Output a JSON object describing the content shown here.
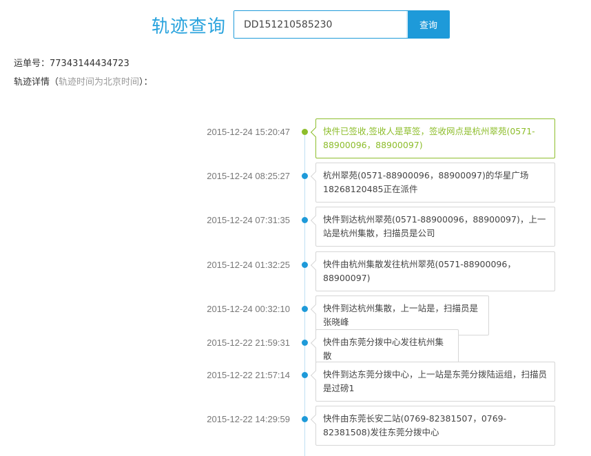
{
  "header": {
    "title": "轨迹查询",
    "search_value": "DD151210585230",
    "search_button": "查询"
  },
  "info": {
    "waybill_label": "运单号：",
    "waybill_number": "77343144434723",
    "detail_label": "轨迹详情（",
    "detail_note": "轨迹时间为北京时间",
    "detail_suffix": "）："
  },
  "events": [
    {
      "time": "2015-12-24 15:20:47",
      "text": "快件已签收,签收人是草签，签收网点是杭州翠苑(0571-88900096，88900097)",
      "current": true
    },
    {
      "time": "2015-12-24 08:25:27",
      "text": "杭州翠苑(0571-88900096，88900097)的华星广场18268120485正在派件",
      "current": false
    },
    {
      "time": "2015-12-24 07:31:35",
      "text": "快件到达杭州翠苑(0571-88900096，88900097)，上一站是杭州集散，扫描员是公司",
      "current": false
    },
    {
      "time": "2015-12-24 01:32:25",
      "text": "快件由杭州集散发往杭州翠苑(0571-88900096，88900097)",
      "current": false
    },
    {
      "time": "2015-12-24 00:32:10",
      "text": "快件到达杭州集散，上一站是，扫描员是张晓峰",
      "current": false
    },
    {
      "time": "2015-12-22 21:59:31",
      "text": "快件由东莞分拨中心发往杭州集散",
      "current": false
    },
    {
      "time": "2015-12-22 21:57:14",
      "text": "快件到达东莞分拨中心，上一站是东莞分拨陆运组，扫描员是过磅1",
      "current": false
    },
    {
      "time": "2015-12-22 14:29:59",
      "text": "快件由东莞长安二站(0769-82381507，0769-82381508)发往东莞分拨中心",
      "current": false
    }
  ]
}
